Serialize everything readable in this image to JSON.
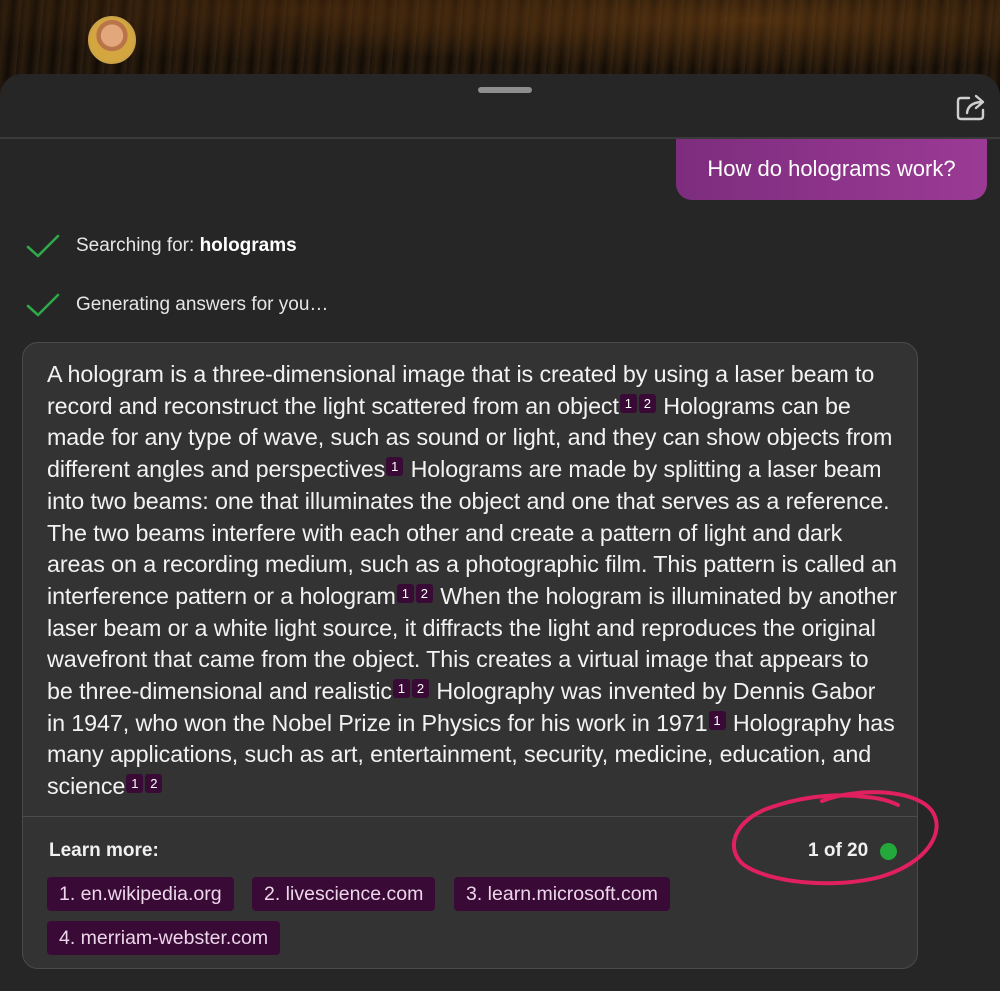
{
  "header": {
    "avatar": "user-avatar",
    "share_icon": "share-icon"
  },
  "conversation": {
    "user_message": "How do holograms work?",
    "status": [
      {
        "prefix": "Searching for: ",
        "emphasis": "holograms",
        "icon": "checkmark-icon"
      },
      {
        "prefix": "Generating answers for you…",
        "emphasis": "",
        "icon": "checkmark-icon"
      }
    ]
  },
  "answer": {
    "segments": [
      "A hologram is a three-dimensional image that is created by using a laser beam to record and reconstruct the light scattered from an object",
      "Holograms can be made for any type of wave, such as sound or light, and they can show objects from different angles and perspectives",
      "Holograms are made by splitting a laser beam into two beams: one that illuminates the object and one that serves as a reference. The two beams interfere with each other and create a pattern of light and dark areas on a recording medium, such as a photographic film. This pattern is called an interference pattern or a hologram",
      "When the hologram is illuminated by another laser beam or a white light source, it diffracts the light and reproduces the original wavefront that came from the object. This creates a virtual image that appears to be three-dimensional and realistic",
      "Holography was invented by Dennis Gabor in 1947, who won the Nobel Prize in Physics for his work in 1971",
      "Holography has many applications, such as art, entertainment, security, medicine, education, and science"
    ],
    "citations": {
      "c1a": "1",
      "c1b": "2",
      "c2a": "1",
      "c3a": "1",
      "c3b": "2",
      "c4a": "1",
      "c4b": "2",
      "c5a": "1",
      "c6a": "1",
      "c6b": "2"
    },
    "learn_more_label": "Learn more:",
    "counter": "1 of 20",
    "status_dot_color": "#22a83b",
    "sources": [
      "1. en.wikipedia.org",
      "2. livescience.com",
      "3. learn.microsoft.com",
      "4. merriam-webster.com"
    ]
  },
  "colors": {
    "accent": "#9b3a95",
    "citation_bg": "#3a0a36",
    "annotation": "#e0205f"
  }
}
